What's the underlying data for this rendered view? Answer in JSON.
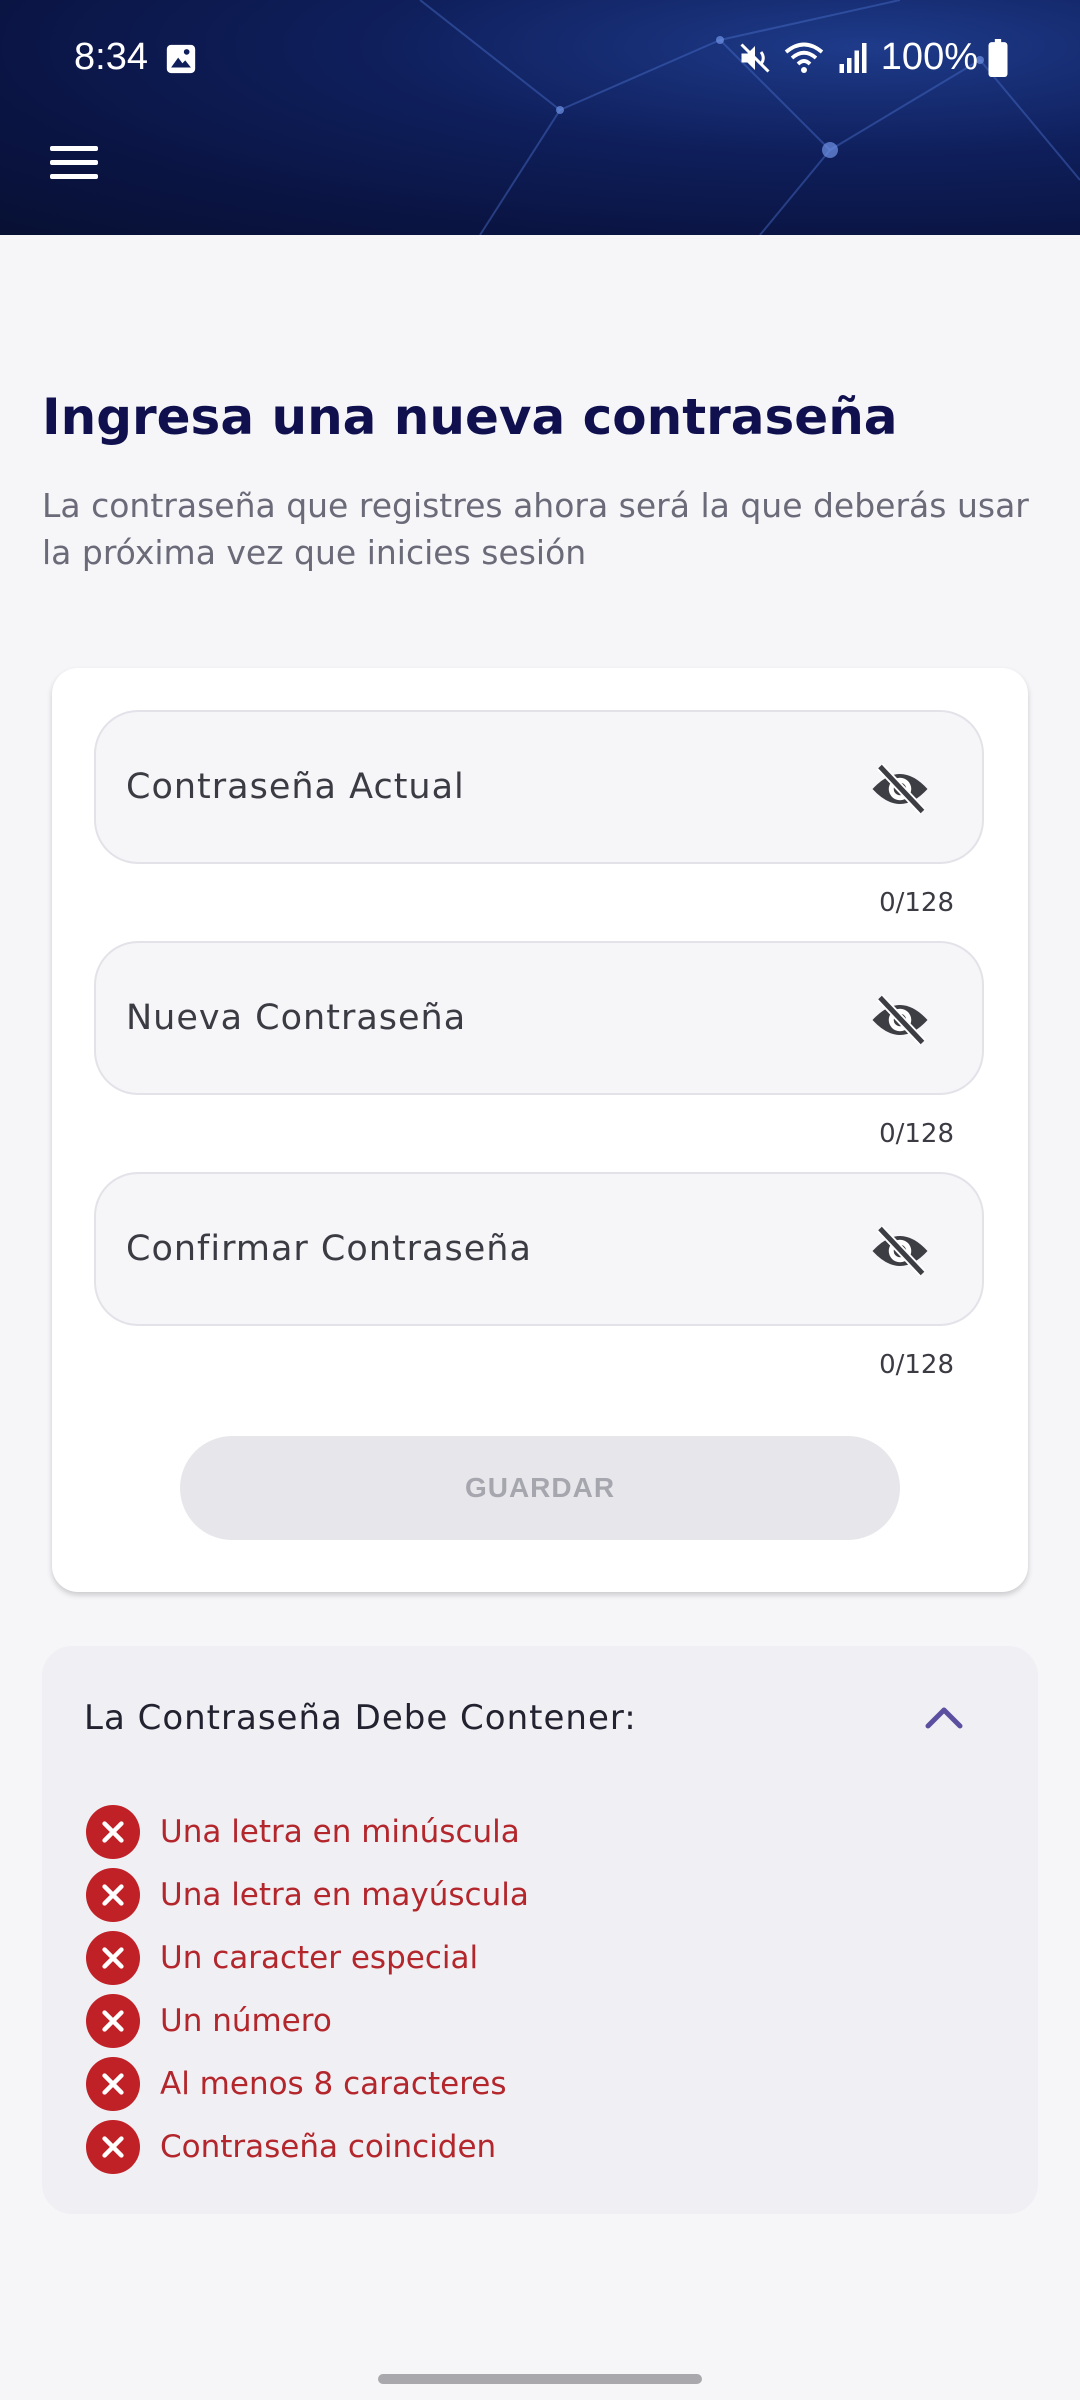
{
  "status_bar": {
    "time": "8:34",
    "battery": "100%",
    "icons": [
      "gallery-icon",
      "mute-icon",
      "wifi-icon",
      "signal-icon",
      "battery-icon"
    ]
  },
  "header": {
    "menu_icon": "hamburger-menu-icon"
  },
  "page": {
    "title": "Ingresa una nueva contraseña",
    "subtitle": "La contraseña que registres ahora será la que deberás usar la próxima vez que inicies sesión"
  },
  "form": {
    "fields": [
      {
        "label": "Contraseña Actual",
        "counter": "0/128",
        "icon": "eye-off-icon"
      },
      {
        "label": "Nueva Contraseña",
        "counter": "0/128",
        "icon": "eye-off-icon"
      },
      {
        "label": "Confirmar Contraseña",
        "counter": "0/128",
        "icon": "eye-off-icon"
      }
    ],
    "save_label": "GUARDAR"
  },
  "requirements": {
    "title": "La Contraseña Debe Contener:",
    "toggle_icon": "chevron-up-icon",
    "items": [
      "Una letra en minúscula",
      "Una letra en mayúscula",
      "Un caracter especial",
      "Un número",
      "Al menos 8 caracteres",
      "Contraseña coinciden"
    ]
  },
  "colors": {
    "title": "#10104f",
    "error": "#c02127",
    "accent": "#5b4fa0",
    "header": "#0f1f5c"
  }
}
